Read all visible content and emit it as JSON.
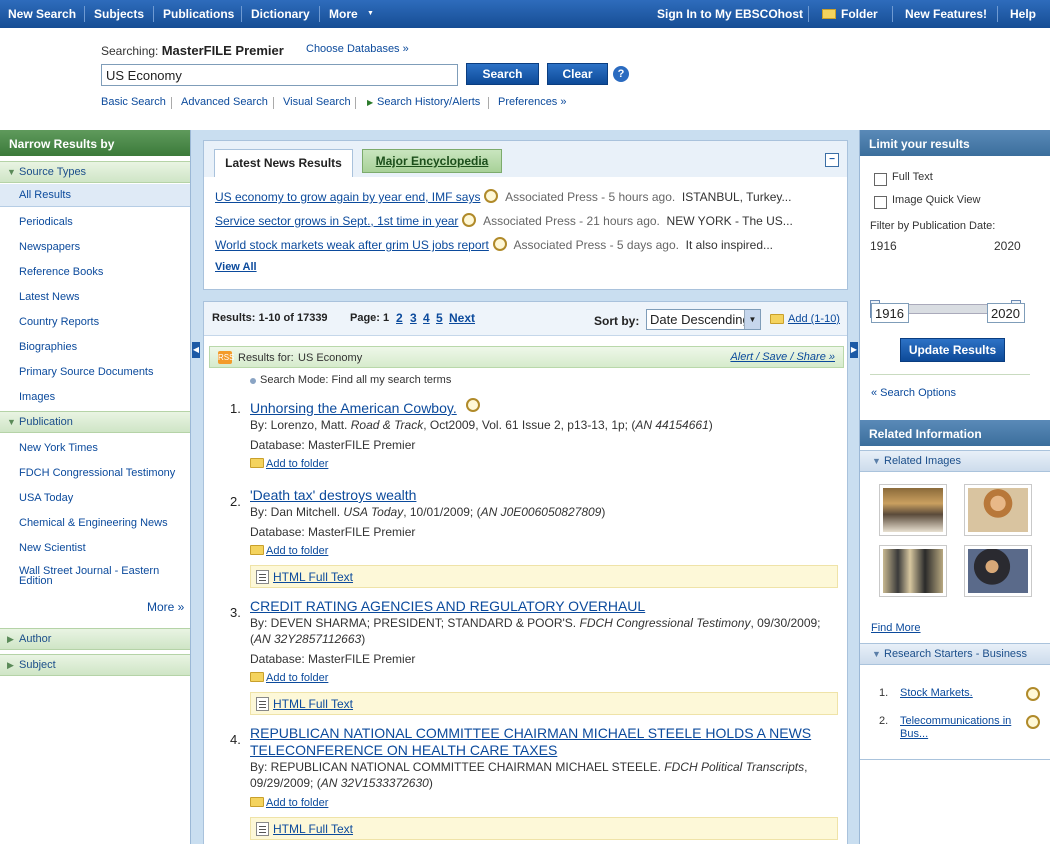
{
  "topnav": {
    "new_search": "New Search",
    "subjects": "Subjects",
    "publications": "Publications",
    "dictionary": "Dictionary",
    "more": "More",
    "more_arrow": "▼",
    "sign_in": "Sign In to My EBSCOhost",
    "folder": "Folder",
    "new_features": "New Features!",
    "help": "Help"
  },
  "search": {
    "searching_label": "Searching:",
    "database": "MasterFILE Premier",
    "choose_db": "Choose Databases »",
    "query": "US Economy",
    "search_btn": "Search",
    "clear_btn": "Clear",
    "help_icon": "?"
  },
  "sublinks": {
    "basic": "Basic Search",
    "advanced": "Advanced Search",
    "visual": "Visual Search",
    "history": "Search History/Alerts",
    "preferences": "Preferences »"
  },
  "left": {
    "header": "Narrow Results by",
    "source_types": "Source Types",
    "all_results": "All Results",
    "sources": [
      "Periodicals",
      "Newspapers",
      "Reference Books",
      "Latest News",
      "Country Reports",
      "Biographies",
      "Primary Source Documents",
      "Images"
    ],
    "publication": "Publication",
    "pubs": [
      "New York Times",
      "FDCH Congressional Testimony",
      "USA Today",
      "Chemical & Engineering News",
      "New Scientist",
      "Wall Street Journal - Eastern",
      "Edition"
    ],
    "more": "More »",
    "author": "Author",
    "subject": "Subject"
  },
  "news": {
    "tab1": "Latest News Results",
    "tab2": "Major Encyclopedia",
    "collapse": "−",
    "items": [
      {
        "title": "US economy to grow again by year end, IMF says",
        "source": "Associated Press - 5 hours ago.",
        "snippet": "ISTANBUL, Turkey..."
      },
      {
        "title": "Service sector grows in Sept., 1st time in year",
        "source": "Associated Press - 21 hours ago.",
        "snippet": "NEW YORK - The US..."
      },
      {
        "title": "World stock markets weak after grim US jobs report",
        "source": "Associated Press - 5 days ago.",
        "snippet": "It also inspired..."
      }
    ],
    "view_all": "View All"
  },
  "results": {
    "summary": "Results: 1-10 of 17339",
    "page_label": "Page: 1",
    "pages": [
      "2",
      "3",
      "4",
      "5"
    ],
    "next": "Next",
    "sort_label": "Sort by:",
    "sort_value": "Date Descending",
    "add": "Add (1-10)",
    "results_for": "Results for:",
    "query": "US Economy",
    "alert": "Alert / Save / Share »",
    "search_mode": "Search Mode: Find all my search terms",
    "rss": "RSS",
    "items": [
      {
        "num": "1.",
        "title": "Unhorsing the American Cowboy.",
        "by": "By: Lorenzo, Matt.",
        "pub": "Road & Track",
        "rest": ", Oct2009, Vol. 61 Issue 2, p13-13, 1p; (",
        "an": "AN 44154661",
        "end": ")",
        "db": "Database: MasterFILE Premier",
        "add": "Add to folder"
      },
      {
        "num": "2.",
        "title": "'Death tax' destroys wealth",
        "by": "By: Dan Mitchell.",
        "pub": "USA Today",
        "rest": ", 10/01/2009; (",
        "an": "AN J0E006050827809",
        "end": ")",
        "db": "Database: MasterFILE Premier",
        "add": "Add to folder",
        "ft": "HTML Full Text"
      },
      {
        "num": "3.",
        "title": "CREDIT RATING AGENCIES AND REGULATORY OVERHAUL",
        "by": "By: DEVEN SHARMA; PRESIDENT; STANDARD & POOR'S.",
        "pub": "FDCH Congressional Testimony",
        "rest": ", 09/30/2009;",
        "an": "AN 32Y2857112663",
        "end": ")",
        "db": "Database: MasterFILE Premier",
        "add": "Add to folder",
        "ft": "HTML Full Text"
      },
      {
        "num": "4.",
        "title": "REPUBLICAN NATIONAL COMMITTEE CHAIRMAN MICHAEL STEELE HOLDS A NEWS TELECONFERENCE ON HEALTH CARE TAXES",
        "by": "By: REPUBLICAN NATIONAL COMMITTEE CHAIRMAN MICHAEL STEELE.",
        "pub": "FDCH Political Transcripts",
        "rest": ",",
        "an": "AN 32V1533372630",
        "date": "09/29/2009; (",
        "end": ")",
        "add": "Add to folder",
        "ft": "HTML Full Text"
      }
    ]
  },
  "right": {
    "header": "Limit your results",
    "full_text": "Full Text",
    "image_quick": "Image Quick View",
    "filter_label": "Filter by Publication Date:",
    "year_min": "1916",
    "year_max": "2020",
    "from": "1916",
    "to": "2020",
    "update": "Update Results",
    "options": "« Search Options",
    "related": "Related Information",
    "related_images": "Related Images",
    "find_more": "Find More",
    "starters": "Research Starters - Business",
    "starter_items": [
      {
        "num": "1.",
        "title": "Stock Markets."
      },
      {
        "num": "2.",
        "title": "Telecommunications in Bus..."
      }
    ]
  },
  "colors": {
    "nav": "#1c5aa6",
    "green_head": "#4a8a48",
    "blue_head": "#4a7cac",
    "link": "#0b4a9c"
  }
}
